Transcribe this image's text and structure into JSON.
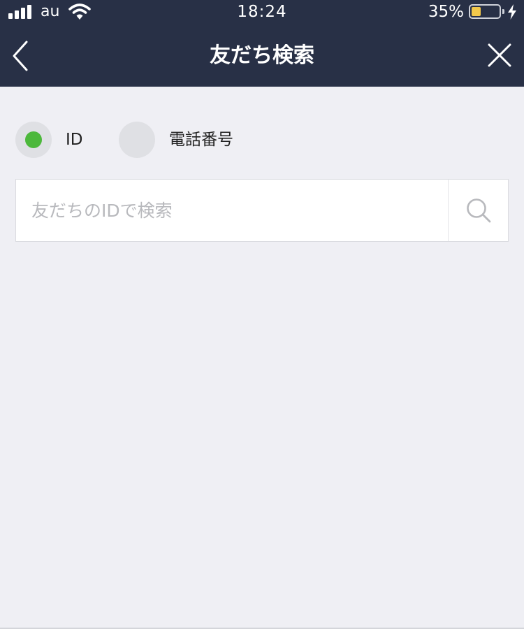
{
  "status_bar": {
    "carrier": "au",
    "time": "18:24",
    "battery_percent": "35%",
    "battery_level": 0.35,
    "charging": true
  },
  "header": {
    "title": "友だち検索",
    "back_icon": "chevron-left-icon",
    "close_icon": "close-icon"
  },
  "search_type": {
    "options": [
      {
        "label": "ID",
        "selected": true
      },
      {
        "label": "電話番号",
        "selected": false
      }
    ],
    "selected_color": "#4cb83b"
  },
  "search": {
    "placeholder": "友だちのIDで検索",
    "value": "",
    "icon": "search-icon"
  },
  "colors": {
    "header_bg": "#283046",
    "page_bg": "#efeff4",
    "battery_fill": "#f2c84b"
  }
}
